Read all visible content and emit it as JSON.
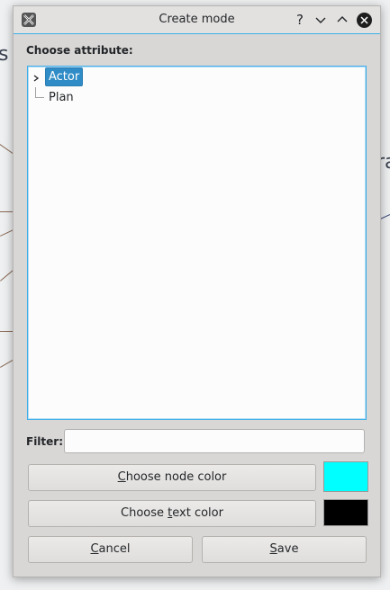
{
  "window": {
    "title": "Create mode",
    "help_glyph": "?",
    "minimize_glyph": "⌄",
    "maximize_glyph": "⌃"
  },
  "background": {
    "fragment_left": "s",
    "fragment_right": "ra"
  },
  "dialog": {
    "choose_attribute_label": "Choose attribute:",
    "tree": [
      {
        "label": "Actor",
        "selected": true,
        "expandable": true
      },
      {
        "label": "Plan",
        "selected": false,
        "expandable": false
      }
    ],
    "filter_label": "Filter:",
    "filter_value": "",
    "node_color_button": {
      "before": "",
      "mnemonic": "C",
      "after": "hoose node color"
    },
    "text_color_button": {
      "before": "Choose ",
      "mnemonic": "t",
      "after": "ext color"
    },
    "node_color": "#00ffff",
    "text_color": "#000000",
    "cancel_button": {
      "before": "",
      "mnemonic": "C",
      "after": "ancel"
    },
    "save_button": {
      "before": "",
      "mnemonic": "S",
      "after": "ave"
    }
  }
}
